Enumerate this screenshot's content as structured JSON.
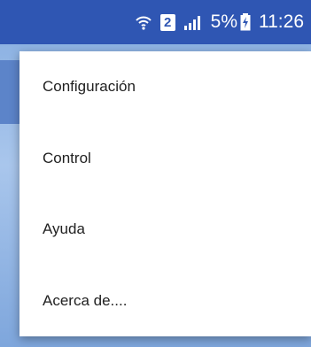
{
  "status_bar": {
    "wifi_icon": "wifi-icon",
    "sim_slot": "2",
    "signal_icon": "signal-icon",
    "battery_percent": "5%",
    "battery_icon": "battery-charging-icon",
    "time": "11:26"
  },
  "menu": {
    "items": [
      {
        "label": "Configuración"
      },
      {
        "label": "Control"
      },
      {
        "label": "Ayuda"
      },
      {
        "label": "Acerca de...."
      }
    ]
  },
  "colors": {
    "status_bar": "#2f56b3",
    "menu_background": "#ffffff",
    "menu_text": "#212121"
  }
}
